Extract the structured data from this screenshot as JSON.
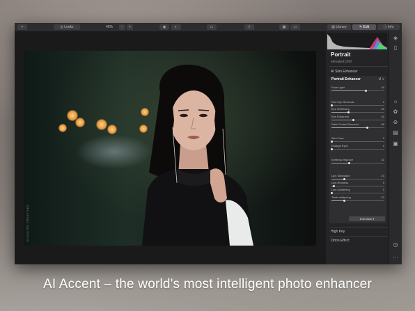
{
  "toolbar": {
    "looks": "Looks",
    "zoom": "45%",
    "zoom_minus": "−",
    "zoom_plus": "+",
    "tabs": [
      {
        "label": "Library",
        "icon": "library-icon"
      },
      {
        "label": "Edit",
        "icon": "edit-icon"
      },
      {
        "label": "Info",
        "icon": "info-icon"
      }
    ],
    "active_tab": "Edit"
  },
  "photo": {
    "watermark": "ELEVATED CREATIVES"
  },
  "panel": {
    "title": "Portrait",
    "filename": "elevated.CR2",
    "ai_skin": "AI Skin Enhancer",
    "group_title": "Portrait Enhancer",
    "sliders": [
      {
        "label": "Face Light",
        "value": "30",
        "fraction": 0.65
      },
      {
        "label": "Red Eye Removal",
        "value": "0",
        "fraction": 0.0
      },
      {
        "label": "Eye Whitening",
        "value": "30",
        "fraction": 0.32
      },
      {
        "label": "Eye Enhancer",
        "value": "40",
        "fraction": 0.42
      },
      {
        "label": "Dark Circles Removal",
        "value": "68",
        "fraction": 0.68
      },
      {
        "label": "Slim Face",
        "value": "0",
        "fraction": 0.0
      },
      {
        "label": "Enlarge Eyes",
        "value": "0",
        "fraction": 0.0
      },
      {
        "label": "Eyebrow Improve",
        "value": "31",
        "fraction": 0.33
      },
      {
        "label": "Lips Saturation",
        "value": "23",
        "fraction": 0.24
      },
      {
        "label": "Lips Redness",
        "value": "5",
        "fraction": 0.05
      },
      {
        "label": "Lips Darkening",
        "value": "0",
        "fraction": 0.0
      },
      {
        "label": "Teeth whitening",
        "value": "22",
        "fraction": 0.24
      }
    ],
    "edit_mask": "Edit Mask ▾",
    "high_key": "High Key",
    "orton": "Orton Effect"
  },
  "caption": "AI Accent – the world's most intelligent photo enhancer",
  "colors": {
    "app_bg": "#1c1c1e",
    "panel_bg": "#242426",
    "accent": "#ffffff"
  }
}
